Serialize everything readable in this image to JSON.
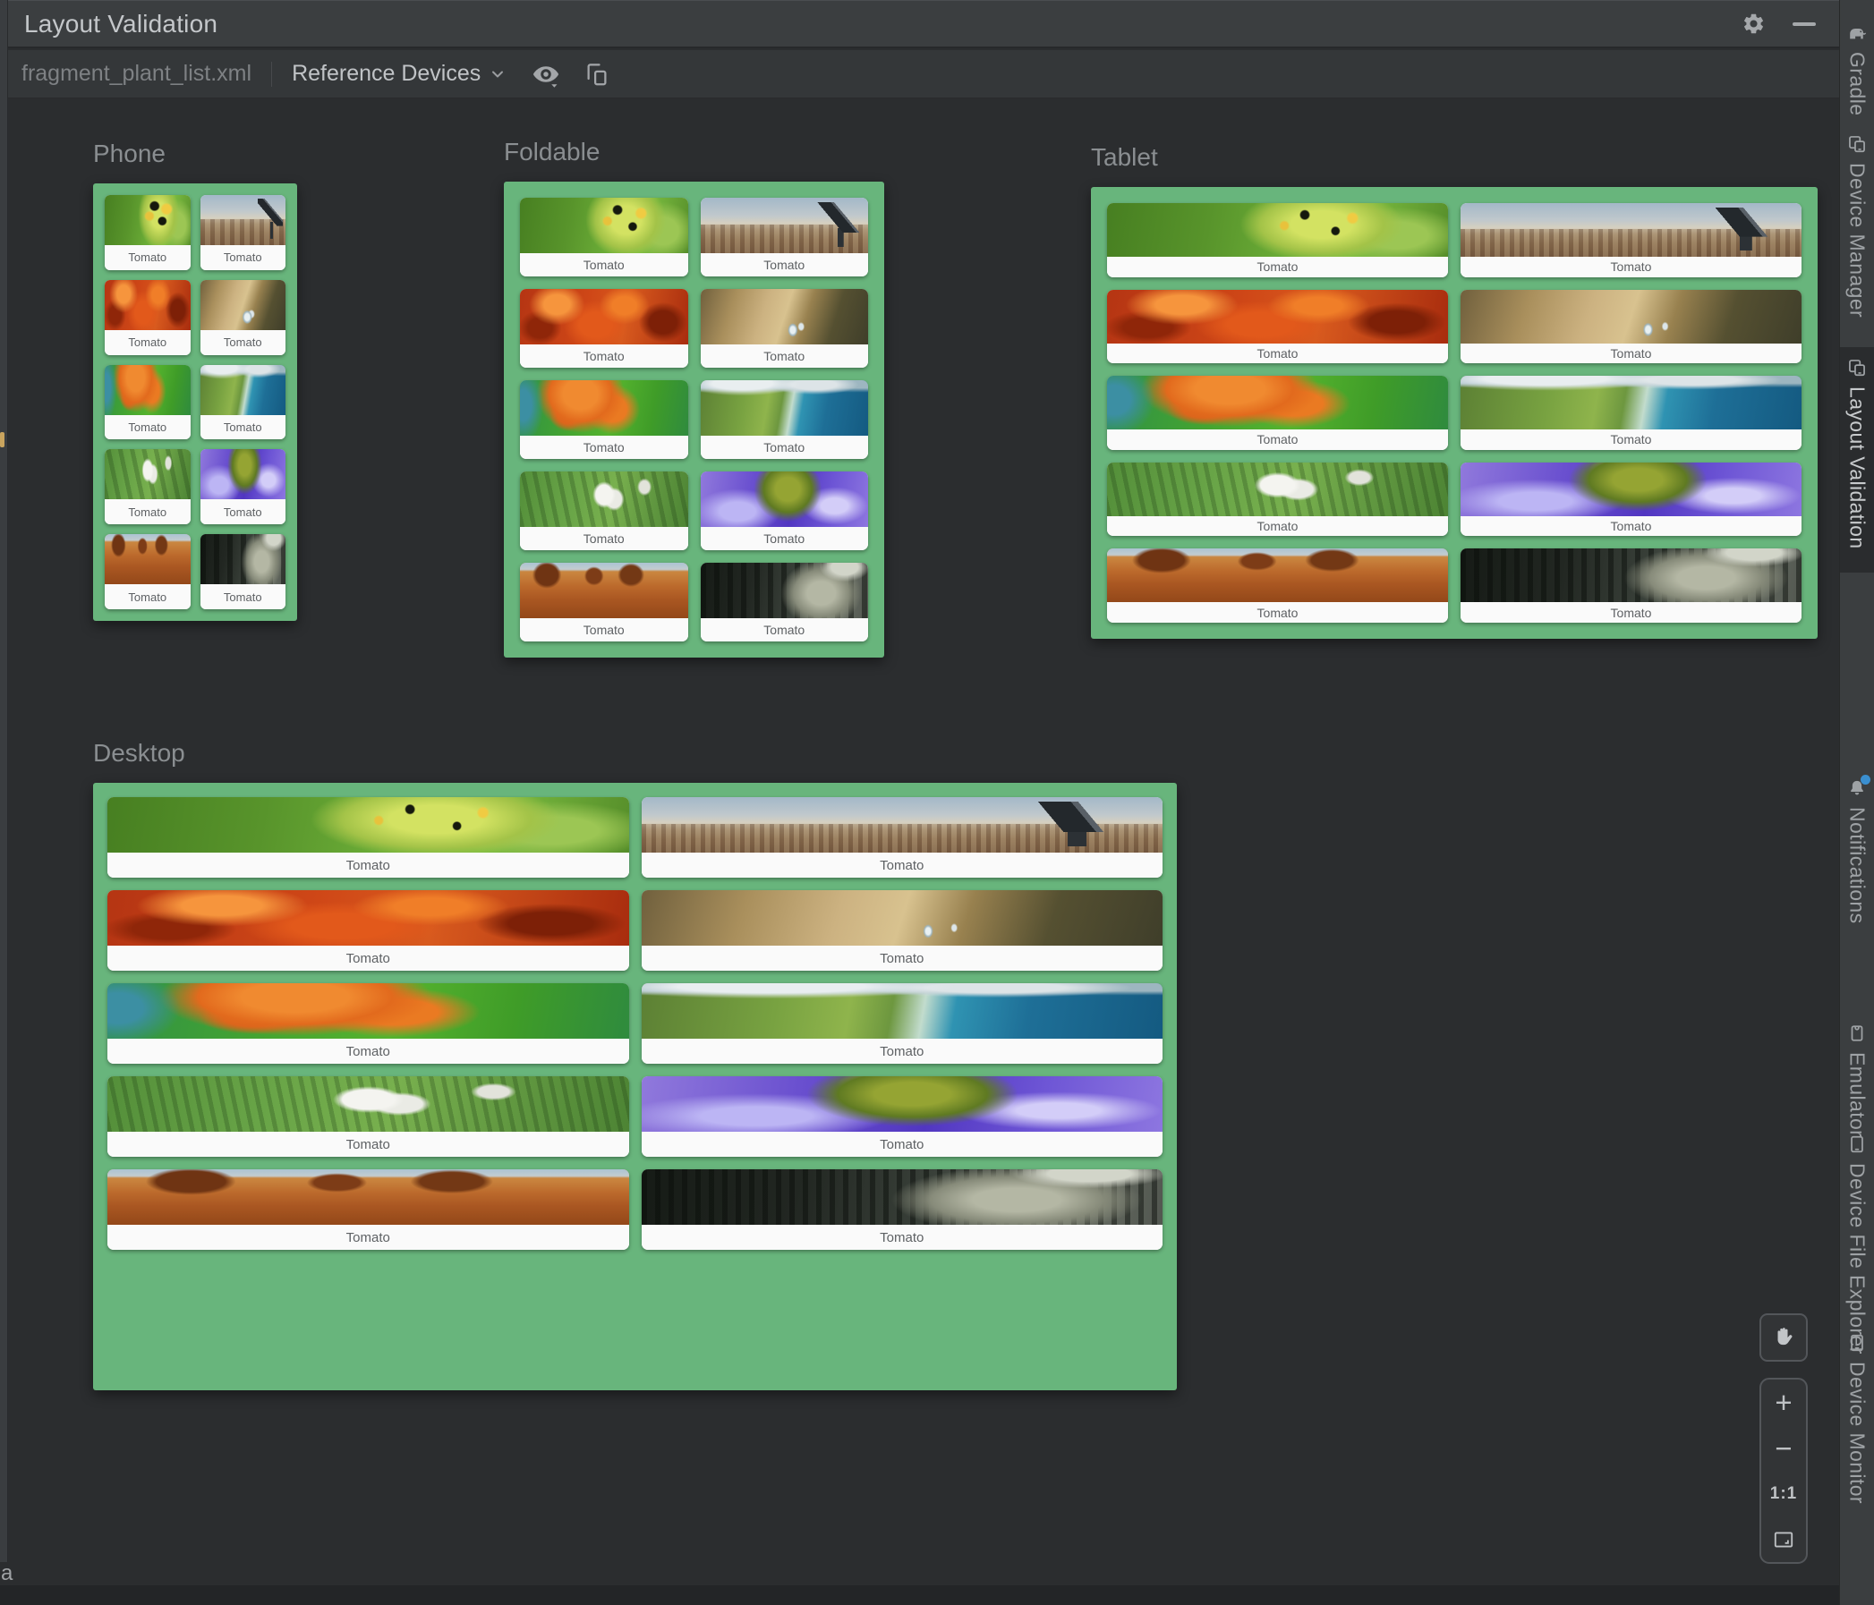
{
  "titlebar": {
    "title": "Layout Validation",
    "settings_icon": "gear-icon",
    "minimize_icon": "minimize-icon"
  },
  "toolbar": {
    "file_name": "fragment_plant_list.xml",
    "device_selector_label": "Reference Devices",
    "chevron_icon": "chevron-down-icon",
    "visibility_icon": "eye-icon",
    "copy_icon": "copy-devices-icon"
  },
  "previews": {
    "card_label": "Tomato",
    "image_order": [
      "caterpillar-leaf",
      "telescope-cityscape",
      "red-maple-leaves",
      "wood-water-drops",
      "orange-maple-leaf",
      "coastline-aerial",
      "farm-aerial",
      "purple-river-rocks",
      "desert-buttes",
      "gray-forest"
    ],
    "devices": [
      {
        "id": "phone",
        "name": "Phone"
      },
      {
        "id": "foldable",
        "name": "Foldable"
      },
      {
        "id": "tablet",
        "name": "Tablet"
      },
      {
        "id": "desktop",
        "name": "Desktop"
      }
    ]
  },
  "sidebar": {
    "items": [
      {
        "id": "gradle",
        "label": "Gradle",
        "icon": "gradle-elephant-icon",
        "selected": false,
        "has_badge": false
      },
      {
        "id": "device-manager",
        "label": "Device Manager",
        "icon": "devices-icon",
        "selected": false,
        "has_badge": false
      },
      {
        "id": "layout-validation",
        "label": "Layout Validation",
        "icon": "layout-devices-icon",
        "selected": true,
        "has_badge": false
      },
      {
        "id": "notifications",
        "label": "Notifications",
        "icon": "bell-icon",
        "selected": false,
        "has_badge": true
      },
      {
        "id": "emulator",
        "label": "Emulator",
        "icon": "emulator-icon",
        "selected": false,
        "has_badge": false
      },
      {
        "id": "device-file-explorer",
        "label": "Device File Explorer",
        "icon": "device-icon",
        "selected": false,
        "has_badge": false
      },
      {
        "id": "device-monitor",
        "label": "Device Monitor",
        "icon": "device-icon",
        "selected": false,
        "has_badge": false
      }
    ]
  },
  "zoom_controls": {
    "pan_icon": "hand-icon",
    "zoom_in_label": "+",
    "zoom_out_label": "−",
    "actual_size_label": "1:1",
    "fit_icon": "fit-screen-icon"
  },
  "artifacts": {
    "gutter_letter": "a"
  },
  "colors": {
    "accent_green": "#68B57C",
    "card_bg": "#FAFAFA",
    "notification_badge": "#3A8FD0"
  }
}
